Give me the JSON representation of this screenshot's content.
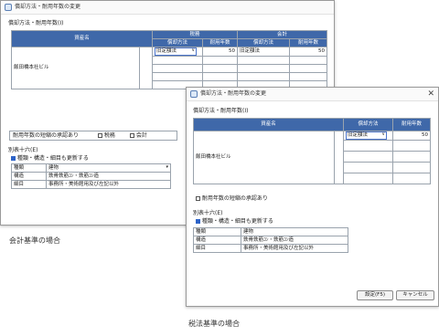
{
  "captions": {
    "accounting": "会計基準の場合",
    "tax": "税法基準の場合"
  },
  "common": {
    "section_title": "償却方法・耐用年数(I)",
    "header_asset": "資産名",
    "header_method": "償却方法",
    "header_life": "耐用年数",
    "asset_name": "飯田橋本社ビル",
    "method_value": "旧定額法",
    "life_value": "50",
    "appendix_title": "別表十六(E)",
    "update_label": "種類・構造・細目も更新する",
    "rows": [
      {
        "label": "種類",
        "value": "建物"
      },
      {
        "label": "構造",
        "value": "鉄骨鉄筋ｺﾝ・鉄筋ｺﾝ造"
      },
      {
        "label": "細目",
        "value": "事務所・美術館用及び左記以外"
      }
    ]
  },
  "win1": {
    "title": "償却方法・耐用年数の変更",
    "group_tax": "税務",
    "group_acc": "会計",
    "shorten_label": "耐用年数の短縮の承認あり",
    "shorten_tax": "税務",
    "shorten_acc": "会計"
  },
  "win2": {
    "title": "償却方法・耐用年数の変更",
    "shorten_label": "耐用年数の短縮の承認あり",
    "ok_label": "設定(F5)",
    "cancel_label": "キャンセル"
  }
}
